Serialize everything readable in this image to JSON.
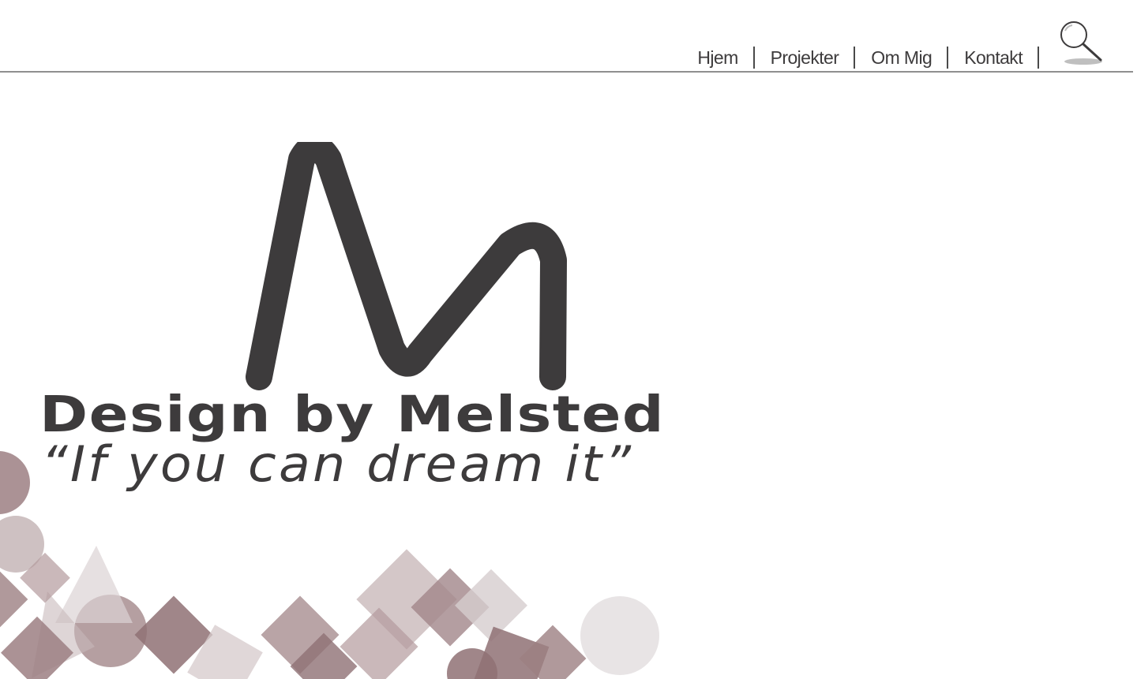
{
  "nav": {
    "items": [
      {
        "label": "Hjem"
      },
      {
        "label": "Projekter"
      },
      {
        "label": "Om Mig"
      },
      {
        "label": "Kontakt"
      }
    ],
    "search_icon": "magnifying-glass-icon"
  },
  "hero": {
    "brand_name": "Design by Melsted",
    "tagline": "“If you can dream it”",
    "logo_letter": "M"
  },
  "colors": {
    "text": "#3d3b3c",
    "divider": "#8f8f8f",
    "accent_mauve": "#9c7f82",
    "accent_light": "#d9cfd0"
  }
}
